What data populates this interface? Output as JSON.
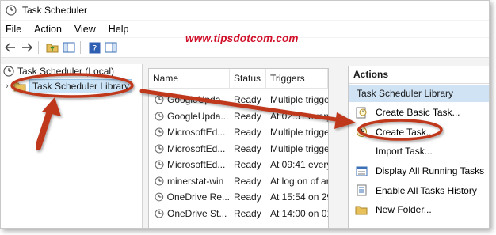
{
  "window": {
    "title": "Task Scheduler"
  },
  "menu": [
    "File",
    "Action",
    "View",
    "Help"
  ],
  "watermark": "www.tipsdotcom.com",
  "tree": {
    "root": "Task Scheduler (Local)",
    "child": "Task Scheduler Library"
  },
  "task_list": {
    "columns": [
      "Name",
      "Status",
      "Triggers"
    ],
    "rows": [
      {
        "name": "GoogleUpda...",
        "status": "Ready",
        "trigger": "Multiple trigge"
      },
      {
        "name": "GoogleUpda...",
        "status": "Ready",
        "trigger": "At 02:51 every"
      },
      {
        "name": "MicrosoftEd...",
        "status": "Ready",
        "trigger": "Multiple trigge"
      },
      {
        "name": "MicrosoftEd...",
        "status": "Ready",
        "trigger": "Multiple trigge"
      },
      {
        "name": "MicrosoftEd...",
        "status": "Ready",
        "trigger": "At 09:41 every"
      },
      {
        "name": "minerstat-win",
        "status": "Ready",
        "trigger": "At log on of ar"
      },
      {
        "name": "OneDrive Re...",
        "status": "Ready",
        "trigger": "At 15:54 on 29,"
      },
      {
        "name": "OneDrive St...",
        "status": "Ready",
        "trigger": "At 14:00 on 01"
      }
    ]
  },
  "actions_panel": {
    "heading": "Actions",
    "section": "Task Scheduler Library",
    "items": [
      {
        "label": "Create Basic Task...",
        "icon": "create-basic-task-icon"
      },
      {
        "label": "Create Task...",
        "icon": "create-task-icon"
      },
      {
        "label": "Import Task...",
        "icon": "import-task-icon"
      },
      {
        "label": "Display All Running Tasks",
        "icon": "running-tasks-icon"
      },
      {
        "label": "Enable All Tasks History",
        "icon": "tasks-history-icon"
      },
      {
        "label": "New Folder...",
        "icon": "folder-icon"
      }
    ]
  },
  "colors": {
    "annotation": "#c0391f",
    "watermark": "#d1102a",
    "selection": "#cce4f7"
  }
}
